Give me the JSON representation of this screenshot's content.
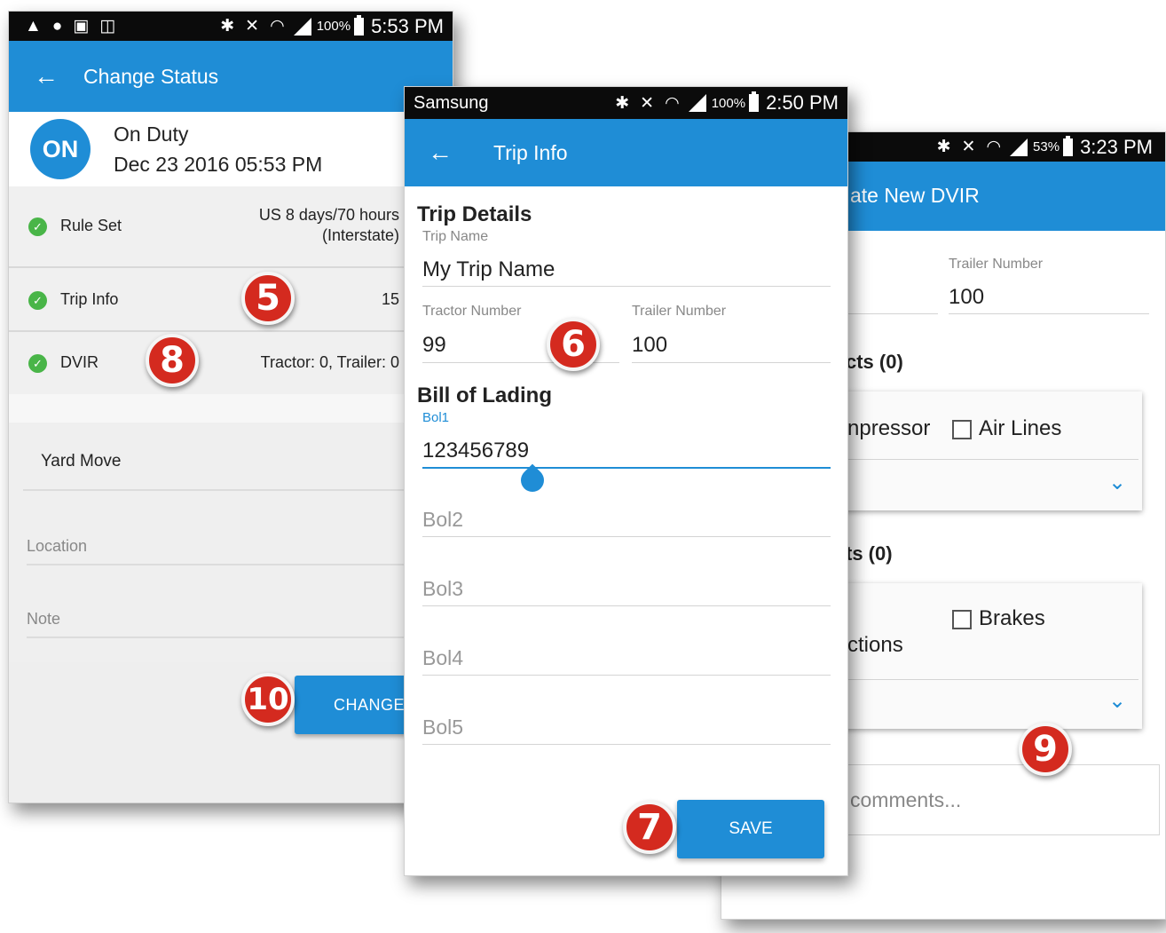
{
  "phone1": {
    "status_bar": {
      "battery": "100%",
      "time": "5:53 PM"
    },
    "app_bar": {
      "title": "Change Status"
    },
    "duty": {
      "badge": "ON",
      "status": "On Duty",
      "timestamp": "Dec 23 2016 05:53 PM"
    },
    "rows": [
      {
        "label": "Rule Set",
        "value_line1": "US 8 days/70 hours",
        "value_line2": "(Interstate)"
      },
      {
        "label": "Trip Info",
        "value": "15"
      },
      {
        "label": "DVIR",
        "value": "Tractor: 0, Trailer: 0"
      }
    ],
    "yard_move": "Yard Move",
    "location_placeholder": "Location",
    "note_placeholder": "Note",
    "change_button": "CHANGE"
  },
  "phone2": {
    "status_bar": {
      "carrier": "Samsung",
      "battery": "100%",
      "time": "2:50 PM"
    },
    "app_bar": {
      "title": "Trip Info"
    },
    "trip_details": {
      "heading": "Trip Details",
      "trip_name_label": "Trip Name",
      "trip_name": "My Trip Name",
      "tractor_label": "Tractor Number",
      "tractor": "99",
      "trailer_label": "Trailer Number",
      "trailer": "100"
    },
    "bill_of_lading": {
      "heading": "Bill of Lading",
      "bol1_label": "Bol1",
      "bol1": "123456789",
      "bol2": "Bol2",
      "bol3": "Bol3",
      "bol4": "Bol4",
      "bol5": "Bol5"
    },
    "save_button": "SAVE"
  },
  "phone3": {
    "status_bar": {
      "battery": "53%",
      "time": "3:23 PM"
    },
    "app_bar": {
      "title": "ate New DVIR"
    },
    "trailer_label": "Trailer Number",
    "trailer": "100",
    "section1": "cts (0)",
    "item_compressor": "npressor",
    "item_air_lines": "Air Lines",
    "section2": "ts (0)",
    "item_brakes": "Brakes",
    "item_connections": "ctions",
    "comments_placeholder": "comments..."
  },
  "callouts": [
    "5",
    "6",
    "7",
    "8",
    "9",
    "10"
  ]
}
